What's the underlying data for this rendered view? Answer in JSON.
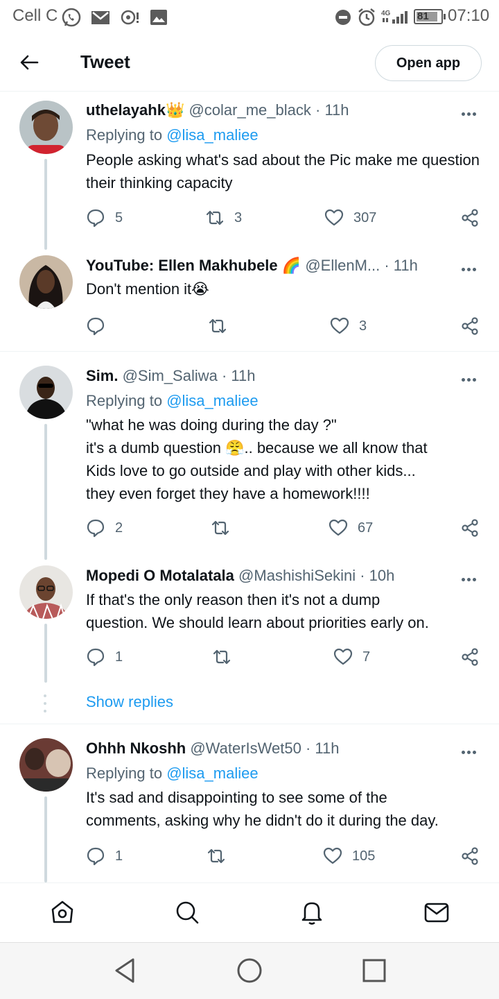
{
  "status_bar": {
    "carrier": "Cell C",
    "battery": "81",
    "time": "07:10",
    "network": "4G"
  },
  "header": {
    "title": "Tweet",
    "open_app_label": "Open app"
  },
  "tweets": [
    {
      "name": "uthelayahk",
      "badge_emoji": "👑",
      "handle": "@colar_me_black",
      "time": "· 11h",
      "replying_prefix": "Replying to ",
      "replying_to": "@lisa_maliee",
      "text": "People asking what's sad about the Pic make me question their thinking capacity",
      "replies": "5",
      "retweets": "3",
      "likes": "307"
    },
    {
      "name": "YouTube: Ellen Makhubele",
      "badge_emoji": "🌈",
      "handle": "@EllenM...",
      "time": "· 11h",
      "text": "Don't mention it😭",
      "replies": "",
      "retweets": "",
      "likes": "3"
    },
    {
      "name": "Sim.",
      "handle": "@Sim_Saliwa",
      "time": "· 11h",
      "replying_prefix": "Replying to ",
      "replying_to": "@lisa_maliee",
      "text_lines": [
        "\"what he was doing during the day ?\"",
        "it's a dumb question 😤.. because we all know that",
        "Kids love to go outside and play with other kids...",
        "they even forget they have a homework!!!!"
      ],
      "replies": "2",
      "retweets": "",
      "likes": "67"
    },
    {
      "name": "Mopedi O Motalatala",
      "handle": "@MashishiSekini",
      "time": "· 10h",
      "text_lines": [
        "If that's the only reason then it's not a dump",
        "question. We should learn about priorities early on."
      ],
      "replies": "1",
      "retweets": "",
      "likes": "7",
      "show_replies": "Show replies"
    },
    {
      "name": "Ohhh Nkoshh",
      "handle": "@WaterIsWet50",
      "time": "· 11h",
      "replying_prefix": "Replying to ",
      "replying_to": "@lisa_maliee",
      "text_lines": [
        "It's sad and disappointing to see some of the",
        "comments, asking why he didn't do it during the day."
      ],
      "replies": "1",
      "retweets": "",
      "likes": "105"
    }
  ],
  "bottom_nav": [
    "home-icon",
    "search-icon",
    "notifications-icon",
    "messages-icon"
  ],
  "system_nav": [
    "back-triangle-icon",
    "home-circle-icon",
    "recents-square-icon"
  ],
  "colors": {
    "accent": "#1d9bf0",
    "text_primary": "#0f1419",
    "text_secondary": "#536471",
    "thread_line": "#cfd9de"
  }
}
